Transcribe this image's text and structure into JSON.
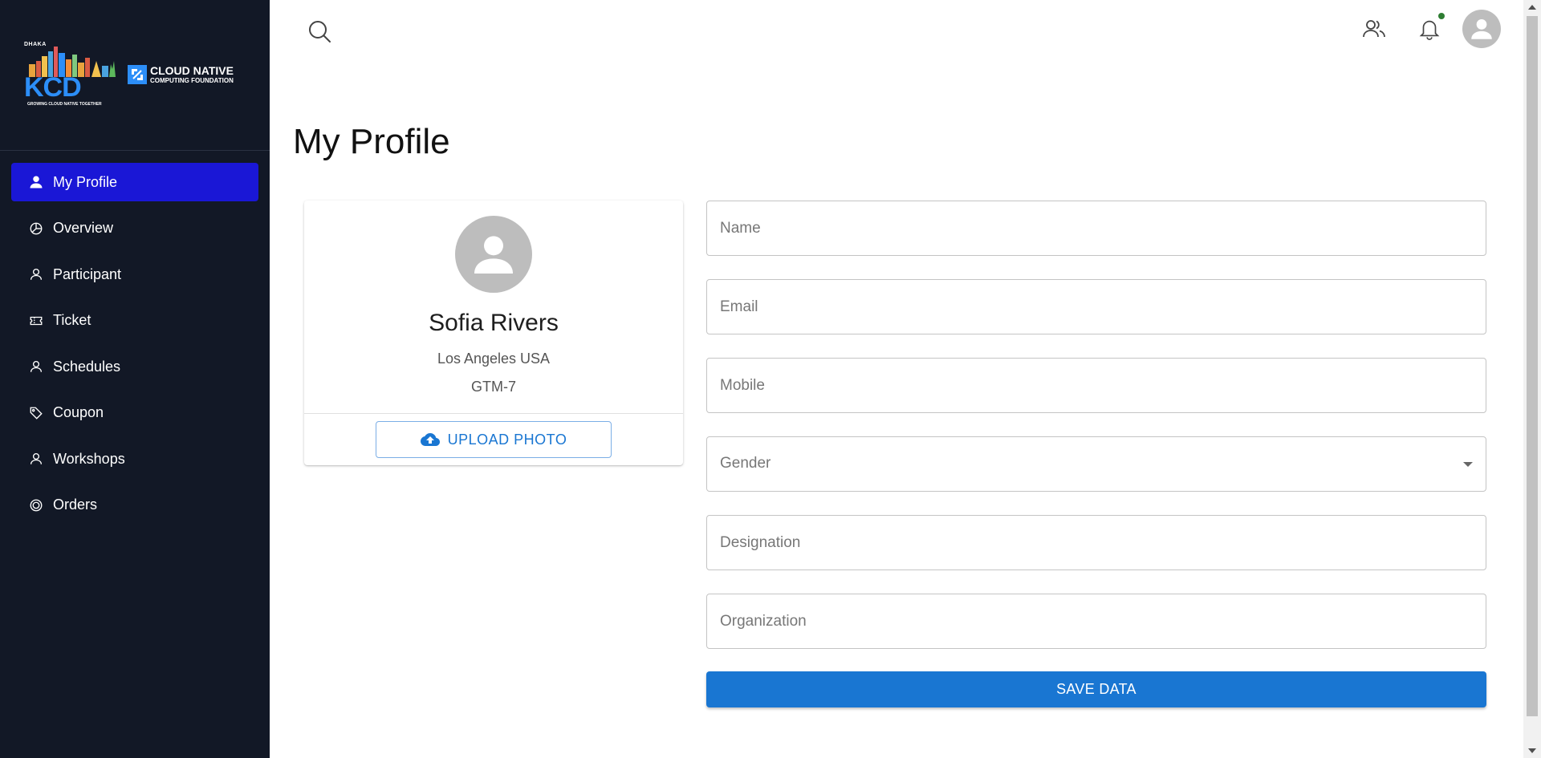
{
  "sidebar": {
    "logo": {
      "kcd_city": "DHAKA",
      "kcd_text": "KCD",
      "kcd_tagline": "GROWING CLOUD NATIVE TOGETHER",
      "cncf_title": "CLOUD NATIVE",
      "cncf_subtitle": "COMPUTING FOUNDATION"
    },
    "items": [
      {
        "label": "My Profile",
        "icon": "person-icon",
        "active": true
      },
      {
        "label": "Overview",
        "icon": "pie-chart-icon",
        "active": false
      },
      {
        "label": "Participant",
        "icon": "person-outline-icon",
        "active": false
      },
      {
        "label": "Ticket",
        "icon": "ticket-icon",
        "active": false
      },
      {
        "label": "Schedules",
        "icon": "person-outline-icon",
        "active": false
      },
      {
        "label": "Coupon",
        "icon": "tag-icon",
        "active": false
      },
      {
        "label": "Workshops",
        "icon": "person-outline-icon",
        "active": false
      },
      {
        "label": "Orders",
        "icon": "target-icon",
        "active": false
      }
    ]
  },
  "header": {
    "icons": [
      "search-icon",
      "users-icon",
      "bell-icon",
      "account-avatar"
    ],
    "notification_dot_color": "#2e7d32"
  },
  "main": {
    "title": "My Profile"
  },
  "profile_card": {
    "name": "Sofia Rivers",
    "location": "Los Angeles USA",
    "timezone": "GTM-7",
    "upload_label": "UPLOAD PHOTO"
  },
  "form": {
    "name_placeholder": "Name",
    "email_placeholder": "Email",
    "mobile_placeholder": "Mobile",
    "gender_label": "Gender",
    "designation_placeholder": "Designation",
    "organization_placeholder": "Organization",
    "save_label": "SAVE DATA"
  },
  "colors": {
    "sidebar_bg": "#121826",
    "active_item_bg": "#1a17d6",
    "primary": "#1976d2",
    "kcd_blue": "#2c8ef8"
  }
}
